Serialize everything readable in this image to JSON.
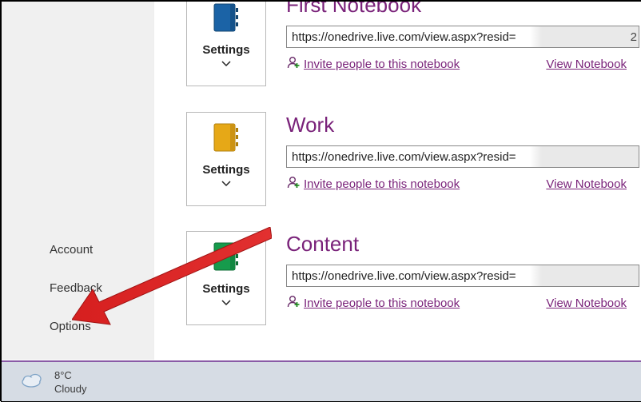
{
  "sidebar": {
    "items": [
      {
        "label": "Account"
      },
      {
        "label": "Feedback"
      },
      {
        "label": "Options"
      }
    ]
  },
  "tile": {
    "label": "Settings"
  },
  "notebooks": [
    {
      "title": "First Notebook",
      "color": "#1b63a6",
      "url": "https://onedrive.live.com/view.aspx?resid=",
      "url_tail": "2",
      "invite": "Invite people to this notebook",
      "view": "View Notebook"
    },
    {
      "title": "Work",
      "color": "#e6a817",
      "url": "https://onedrive.live.com/view.aspx?resid=",
      "url_tail": "",
      "invite": "Invite people to this notebook",
      "view": "View Notebook"
    },
    {
      "title": "Content",
      "color": "#169b4c",
      "url": "https://onedrive.live.com/view.aspx?resid=",
      "url_tail": "",
      "invite": "Invite people to this notebook",
      "view": "View Notebook"
    }
  ],
  "weather": {
    "temp": "8°C",
    "desc": "Cloudy"
  }
}
